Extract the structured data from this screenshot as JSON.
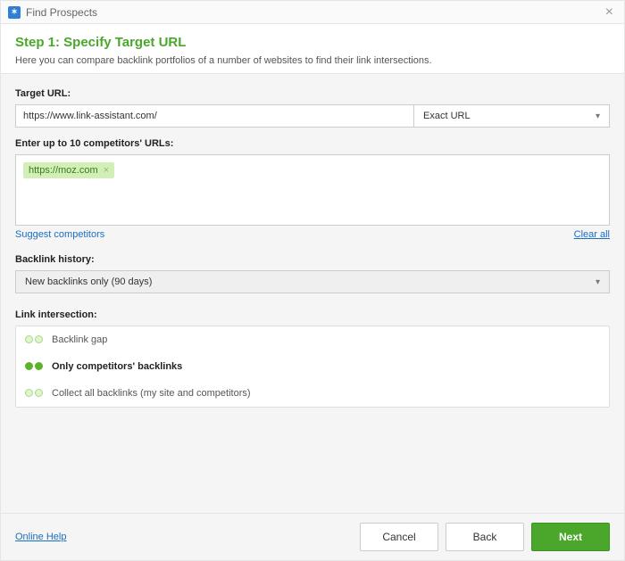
{
  "window": {
    "title": "Find Prospects"
  },
  "header": {
    "step_title": "Step 1: Specify Target URL",
    "description": "Here you can compare backlink portfolios of a number of websites to find their link intersections."
  },
  "target": {
    "label": "Target URL:",
    "value": "https://www.link-assistant.com/",
    "match_mode": "Exact URL"
  },
  "competitors": {
    "label": "Enter up to 10 competitors' URLs:",
    "tags": [
      "https://moz.com"
    ],
    "suggest_label": "Suggest competitors",
    "clear_label": "Clear all"
  },
  "history": {
    "label": "Backlink history:",
    "value": "New backlinks only (90 days)"
  },
  "intersection": {
    "label": "Link intersection:",
    "options": [
      {
        "label": "Backlink gap",
        "selected": false
      },
      {
        "label": "Only competitors' backlinks",
        "selected": true
      },
      {
        "label": "Collect all backlinks (my site and competitors)",
        "selected": false
      }
    ]
  },
  "footer": {
    "help": "Online Help",
    "cancel": "Cancel",
    "back": "Back",
    "next": "Next"
  }
}
